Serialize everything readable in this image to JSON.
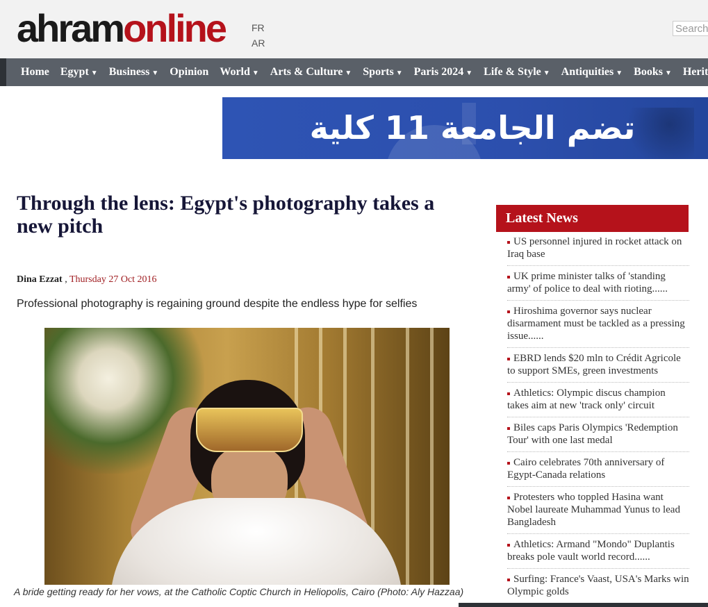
{
  "header": {
    "logo_part1": "ahram",
    "logo_part2": "online",
    "lang_fr": "FR",
    "lang_ar": "AR",
    "search_placeholder": "Search"
  },
  "nav": {
    "items": [
      {
        "label": "Home",
        "dropdown": false
      },
      {
        "label": "Egypt",
        "dropdown": true
      },
      {
        "label": "Business",
        "dropdown": true
      },
      {
        "label": "Opinion",
        "dropdown": false
      },
      {
        "label": "World",
        "dropdown": true
      },
      {
        "label": "Arts & Culture",
        "dropdown": true
      },
      {
        "label": "Sports",
        "dropdown": true
      },
      {
        "label": "Paris 2024",
        "dropdown": true
      },
      {
        "label": "Life & Style",
        "dropdown": true
      },
      {
        "label": "Antiquities",
        "dropdown": true
      },
      {
        "label": "Books",
        "dropdown": true
      },
      {
        "label": "Heritage",
        "dropdown": false
      }
    ]
  },
  "banner": {
    "text": "تضم الجامعة 11 كلية"
  },
  "article": {
    "headline": "Through the lens: Egypt's photography takes a new pitch",
    "author": "Dina Ezzat",
    "separator": " , ",
    "date": "Thursday 27 Oct 2016",
    "summary": "Professional photography is regaining ground despite the endless hype for selfies",
    "caption": "A bride getting ready for her vows, at the Catholic Coptic Church in Heliopolis, Cairo (Photo: Aly Hazzaa)"
  },
  "latest_news": {
    "title": "Latest News",
    "items": [
      "US personnel injured in rocket attack on Iraq base",
      "UK prime minister talks of 'standing army' of police to deal with rioting......",
      "Hiroshima governor says nuclear disarmament must be tackled as a pressing issue......",
      "EBRD lends $20 mln to Crédit Agricole to support SMEs, green investments",
      "Athletics: Olympic discus champion takes aim at new 'track only' circuit",
      "Biles caps Paris Olympics 'Redemption Tour' with one last medal",
      "Cairo celebrates 70th anniversary of Egypt-Canada relations",
      "Protesters who toppled Hasina want Nobel laureate Muhammad Yunus to lead Bangladesh",
      "Athletics: Armand \"Mondo\" Duplantis breaks pole vault world record......",
      "Surfing: France's Vaast, USA's Marks win Olympic golds"
    ]
  },
  "colors": {
    "brand_red": "#b5121b",
    "nav_bg": "#5a6068",
    "headline_navy": "#161637"
  }
}
